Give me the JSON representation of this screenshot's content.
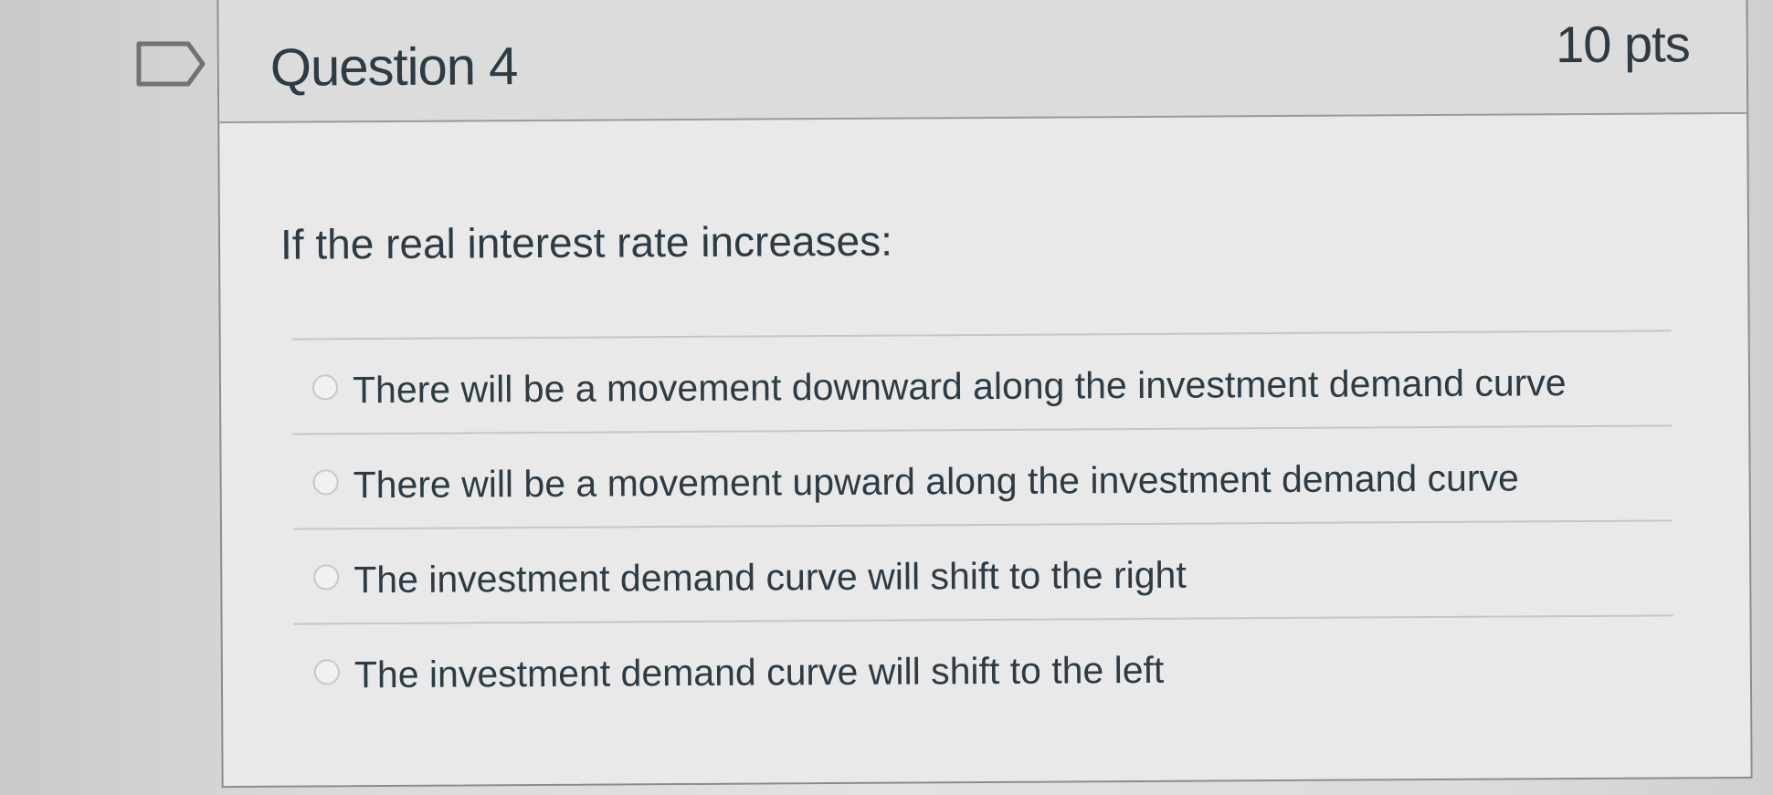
{
  "question": {
    "title": "Question 4",
    "points": "10 pts",
    "text": "If the real interest rate increases:",
    "answers": [
      "There will be a movement downward along the investment demand curve",
      "There will be a movement upward along the investment demand curve",
      "The investment demand curve will shift to the right",
      "The investment demand curve will shift to the left"
    ]
  },
  "icons": {
    "flag": "flag-icon"
  },
  "colors": {
    "text": "#2d3b45",
    "border": "#8c8c8c",
    "header_bg": "#dcdcdc",
    "card_bg": "#e9e9e9"
  }
}
